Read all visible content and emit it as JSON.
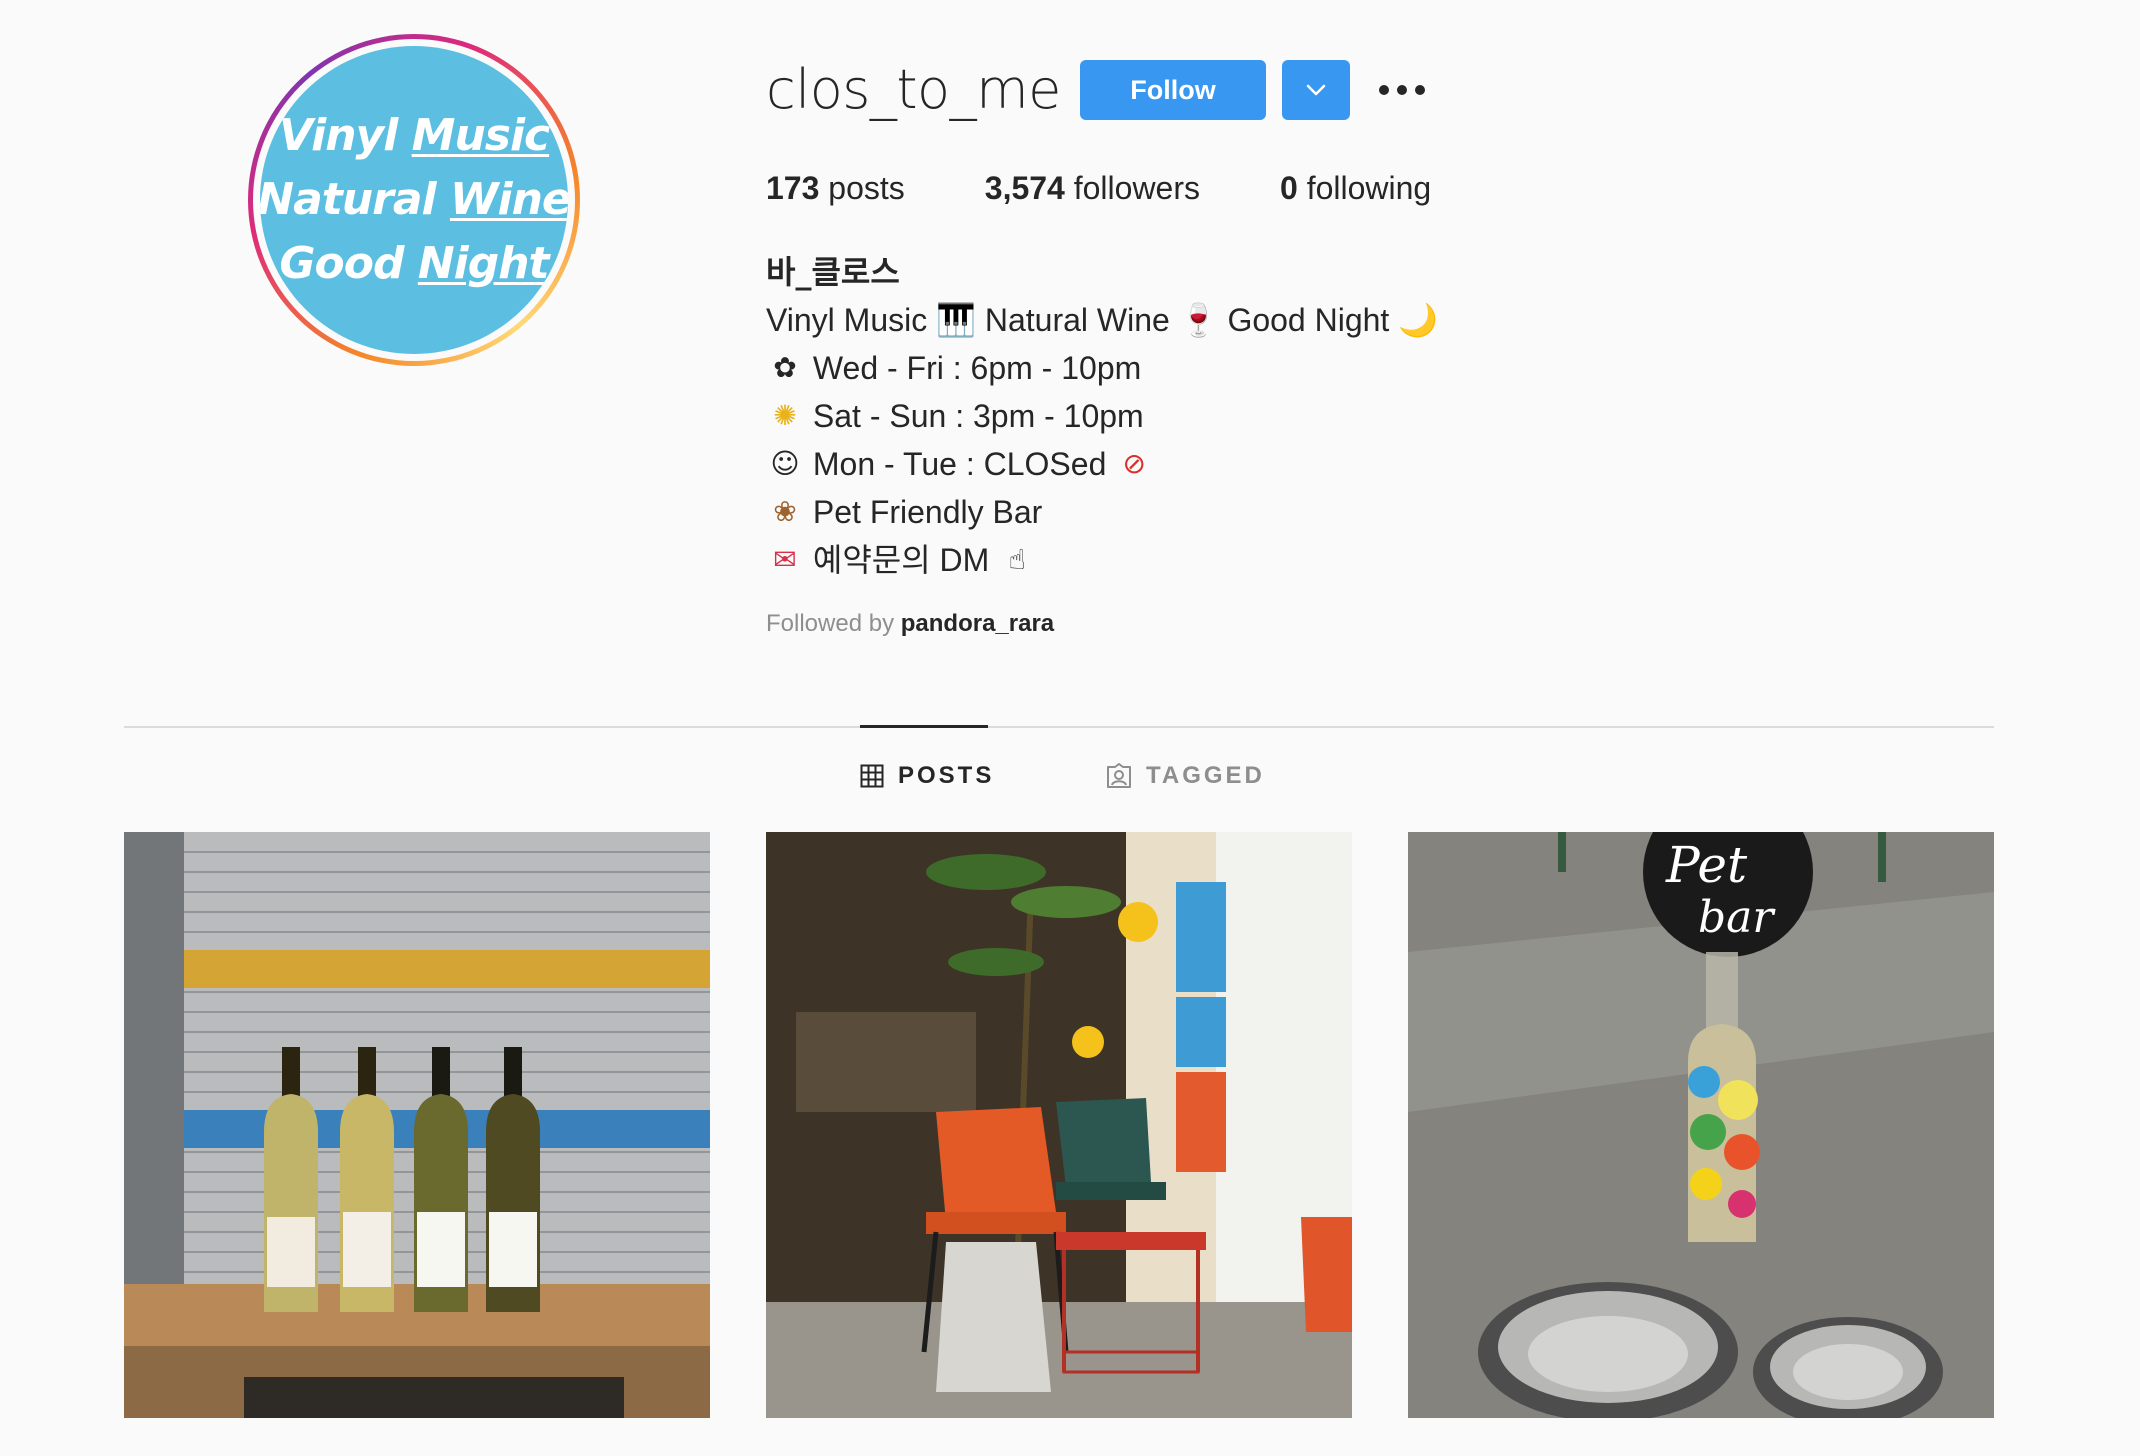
{
  "profile": {
    "username": "clos_to_me",
    "follow_label": "Follow",
    "avatar": {
      "line1_a": "Vinyl ",
      "line1_b": "Music",
      "line2_a": "Natural ",
      "line2_b": "Wine",
      "line3_a": "Good ",
      "line3_b": "Night",
      "bg_color": "#5cbfe1"
    }
  },
  "stats": {
    "posts_count": "173",
    "posts_label": " posts",
    "followers_count": "3,574",
    "followers_label": " followers",
    "following_count": "0",
    "following_label": " following"
  },
  "bio": {
    "name": "바_클로스",
    "line1": "Vinyl Music 🎹 Natural Wine 🍷 Good Night 🌙",
    "line2": "Wed - Fri : 6pm - 10pm",
    "line3": "Sat - Sun : 3pm - 10pm",
    "line4": "Mon - Tue : CLOSed",
    "line5": "Pet Friendly Bar",
    "line6": "예약문의 DM"
  },
  "followed_by": {
    "prefix": "Followed by ",
    "user": "pandora_rara"
  },
  "tabs": [
    {
      "label": "POSTS",
      "icon": "grid-icon",
      "active": true
    },
    {
      "label": "TAGGED",
      "icon": "tagged-icon",
      "active": false
    }
  ],
  "posts": [
    {
      "alt": "wine-bottles-photo"
    },
    {
      "alt": "bar-entrance-chairs-photo"
    },
    {
      "alt": "pet-bar-bottle-photo"
    }
  ],
  "colors": {
    "accent": "#3897f0",
    "text": "#262626",
    "muted": "#8e8e8e",
    "background": "#fafafa"
  }
}
